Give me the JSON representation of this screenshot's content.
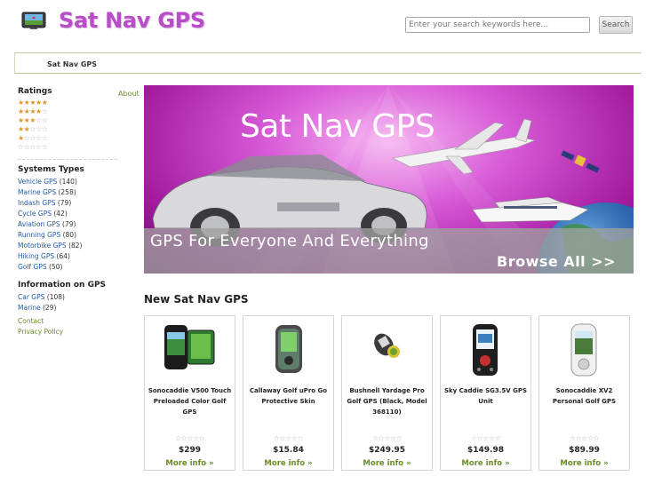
{
  "header": {
    "logo_icon": "sat-nav-device-icon",
    "site_title": "Sat Nav GPS",
    "search_placeholder": "Enter your search keywords here...",
    "search_button": "Search"
  },
  "breadcrumb": {
    "current": "Sat Nav GPS"
  },
  "sidebar": {
    "about": "About",
    "ratings_title": "Ratings",
    "ratings": [
      5,
      4,
      3,
      2,
      1,
      0
    ],
    "systems_title": "Systems Types",
    "systems": [
      {
        "label": "Vehicle GPS",
        "count": "(140)"
      },
      {
        "label": "Marine GPS",
        "count": "(258)"
      },
      {
        "label": "Indash GPS",
        "count": "(79)"
      },
      {
        "label": "Cycle GPS",
        "count": "(42)"
      },
      {
        "label": "Aviation GPS",
        "count": "(79)"
      },
      {
        "label": "Running GPS",
        "count": "(80)"
      },
      {
        "label": "Motorbike GPS",
        "count": "(82)"
      },
      {
        "label": "Hiking GPS",
        "count": "(64)"
      },
      {
        "label": "Golf GPS",
        "count": "(50)"
      }
    ],
    "info_title": "Information on GPS",
    "info": [
      {
        "label": "Car GPS",
        "count": "(108)"
      },
      {
        "label": "Marine",
        "count": "(29)"
      }
    ],
    "contact": "Contact",
    "privacy": "Privacy Policy"
  },
  "banner": {
    "title": "Sat Nav GPS",
    "tagline": "GPS For Everyone And Everything",
    "browse": "Browse All >>"
  },
  "products_section": {
    "title": "New Sat Nav GPS",
    "items": [
      {
        "name": "Sonocaddie V500 Touch Preloaded Color Golf GPS",
        "price": "$299",
        "more": "More info »",
        "rating": 0
      },
      {
        "name": "Callaway Golf uPro Go Protective Skin",
        "price": "$15.84",
        "more": "More info »",
        "rating": 0
      },
      {
        "name": "Bushnell Yardage Pro Golf GPS (Black, Model 368110)",
        "price": "$249.95",
        "more": "More info »",
        "rating": 0
      },
      {
        "name": "Sky Caddie SG3.5V GPS Unit",
        "price": "$149.98",
        "more": "More info »",
        "rating": 0
      },
      {
        "name": "Sonocaddie XV2 Personal Golf GPS",
        "price": "$89.99",
        "more": "More info »",
        "rating": 0
      }
    ]
  },
  "colors": {
    "brand": "#b84dc8",
    "link_blue": "#1f5aa6",
    "link_green": "#6b8c2a",
    "star_on": "#e0962c",
    "star_off": "#bbbbbb"
  }
}
